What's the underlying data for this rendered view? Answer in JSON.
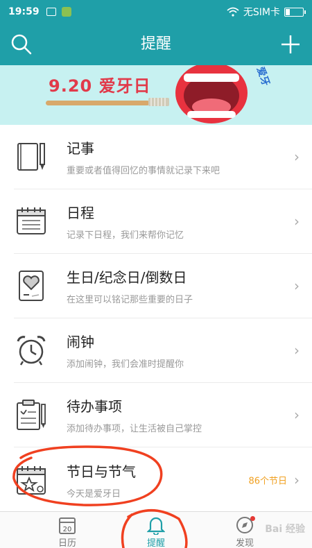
{
  "status_bar": {
    "time": "19:59",
    "carrier": "无SIM卡"
  },
  "header": {
    "title": "提醒"
  },
  "banner": {
    "text": "9.20 爱牙日",
    "side_text": "爱牙"
  },
  "items": [
    {
      "title": "记事",
      "subtitle": "重要或者值得回忆的事情就记录下来吧",
      "icon": "notebook-icon"
    },
    {
      "title": "日程",
      "subtitle": "记录下日程，我们来帮你记忆",
      "icon": "schedule-icon"
    },
    {
      "title": "生日/纪念日/倒数日",
      "subtitle": "在这里可以铭记那些重要的日子",
      "icon": "heart-card-icon"
    },
    {
      "title": "闹钟",
      "subtitle": "添加闹钟，我们会准时提醒你",
      "icon": "alarm-clock-icon"
    },
    {
      "title": "待办事项",
      "subtitle": "添加待办事项，让生活被自己掌控",
      "icon": "clipboard-icon"
    },
    {
      "title": "节日与节气",
      "subtitle": "今天是爱牙日",
      "icon": "calendar-star-icon",
      "count": "86个节日"
    }
  ],
  "tabbar": {
    "tabs": [
      {
        "label": "日历",
        "badge": "20"
      },
      {
        "label": "提醒"
      },
      {
        "label": "发现"
      }
    ],
    "active": "提醒"
  },
  "watermark": "Bai 经验",
  "colors": {
    "primary": "#1f9fa8",
    "annotation": "#f04020",
    "count": "#f0a020"
  }
}
